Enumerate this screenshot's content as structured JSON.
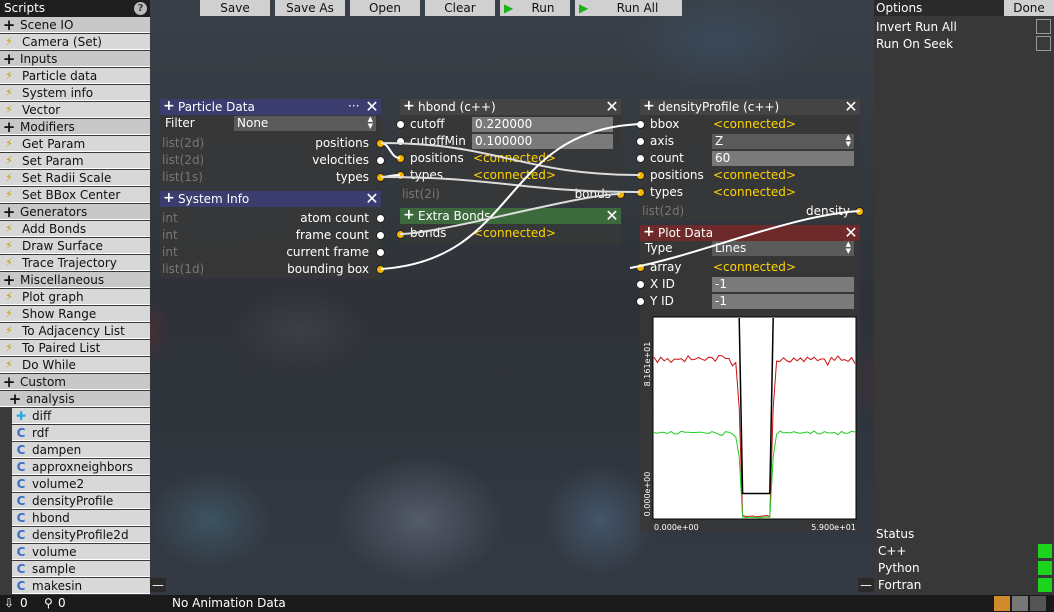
{
  "toolbar": {
    "save": "Save",
    "save_as": "Save As",
    "open": "Open",
    "clear": "Clear",
    "run": "Run",
    "run_all": "Run All"
  },
  "left_panel": {
    "title": "Scripts",
    "help": "?",
    "collapse": "—",
    "items": [
      {
        "label": "Scene IO",
        "icon": "plus-icon",
        "kind": "category"
      },
      {
        "label": "Camera (Set)",
        "icon": "bolt-icon",
        "kind": "item"
      },
      {
        "label": "Inputs",
        "icon": "plus-icon",
        "kind": "category"
      },
      {
        "label": "Particle data",
        "icon": "bolt-icon",
        "kind": "item"
      },
      {
        "label": "System info",
        "icon": "bolt-icon",
        "kind": "item"
      },
      {
        "label": "Vector",
        "icon": "bolt-icon",
        "kind": "item"
      },
      {
        "label": "Modifiers",
        "icon": "plus-icon",
        "kind": "category"
      },
      {
        "label": "Get Param",
        "icon": "bolt-icon",
        "kind": "item"
      },
      {
        "label": "Set Param",
        "icon": "bolt-icon",
        "kind": "item"
      },
      {
        "label": "Set Radii Scale",
        "icon": "bolt-icon",
        "kind": "item"
      },
      {
        "label": "Set BBox Center",
        "icon": "bolt-icon",
        "kind": "item"
      },
      {
        "label": "Generators",
        "icon": "plus-icon",
        "kind": "category"
      },
      {
        "label": "Add Bonds",
        "icon": "bolt-icon",
        "kind": "item"
      },
      {
        "label": "Draw Surface",
        "icon": "bolt-icon",
        "kind": "item"
      },
      {
        "label": "Trace Trajectory",
        "icon": "bolt-icon",
        "kind": "item"
      },
      {
        "label": "Miscellaneous",
        "icon": "plus-icon",
        "kind": "category"
      },
      {
        "label": "Plot graph",
        "icon": "bolt-icon",
        "kind": "item"
      },
      {
        "label": "Show Range",
        "icon": "bolt-icon",
        "kind": "item"
      },
      {
        "label": "To Adjacency List",
        "icon": "bolt-icon",
        "kind": "item"
      },
      {
        "label": "To Paired List",
        "icon": "bolt-icon",
        "kind": "item"
      },
      {
        "label": "Do While",
        "icon": "bolt-icon",
        "kind": "item"
      },
      {
        "label": "Custom",
        "icon": "plus-icon",
        "kind": "category"
      },
      {
        "label": "analysis",
        "icon": "plus-icon",
        "kind": "subcategory"
      },
      {
        "label": "diff",
        "icon": "cross-icon",
        "kind": "script"
      },
      {
        "label": "rdf",
        "icon": "c-icon",
        "kind": "script"
      },
      {
        "label": "dampen",
        "icon": "c-icon",
        "kind": "script"
      },
      {
        "label": "approxneighbors",
        "icon": "c-icon",
        "kind": "script"
      },
      {
        "label": "volume2",
        "icon": "c-icon",
        "kind": "script"
      },
      {
        "label": "densityProfile",
        "icon": "c-icon",
        "kind": "script"
      },
      {
        "label": "hbond",
        "icon": "c-icon",
        "kind": "script"
      },
      {
        "label": "densityProfile2d",
        "icon": "c-icon",
        "kind": "script"
      },
      {
        "label": "volume",
        "icon": "c-icon",
        "kind": "script"
      },
      {
        "label": "sample",
        "icon": "c-icon",
        "kind": "script"
      },
      {
        "label": "makesin",
        "icon": "c-icon",
        "kind": "script"
      }
    ]
  },
  "right_panel": {
    "title": "Options",
    "done": "Done",
    "invert_run_all": "Invert Run All",
    "run_on_seek": "Run On Seek",
    "status_title": "Status",
    "status": [
      {
        "label": "C++",
        "color": "#1cd41c"
      },
      {
        "label": "Python",
        "color": "#1cd41c"
      },
      {
        "label": "Fortran",
        "color": "#1cd41c"
      }
    ],
    "collapse": "—"
  },
  "status_bar": {
    "count1": "0",
    "count2": "0",
    "message": "No Animation Data"
  },
  "nodes": {
    "particle_data": {
      "title": "Particle Data",
      "menu": "···",
      "filter_label": "Filter",
      "filter_value": "None",
      "outputs": [
        {
          "type": "list(2d)",
          "label": "positions"
        },
        {
          "type": "list(2d)",
          "label": "velocities"
        },
        {
          "type": "list(1s)",
          "label": "types"
        }
      ]
    },
    "system_info": {
      "title": "System Info",
      "outputs": [
        {
          "type": "int",
          "label": "atom count"
        },
        {
          "type": "int",
          "label": "frame count"
        },
        {
          "type": "int",
          "label": "current frame"
        },
        {
          "type": "list(1d)",
          "label": "bounding box"
        }
      ]
    },
    "hbond": {
      "title": "hbond (c++)",
      "inputs": [
        {
          "label": "cutoff",
          "value": "0.220000"
        },
        {
          "label": "cutoffMin",
          "value": "0.100000"
        },
        {
          "label": "positions",
          "value": "<connected>"
        },
        {
          "label": "types",
          "value": "<connected>"
        }
      ],
      "output": {
        "type": "list(2i)",
        "label": "bonds"
      }
    },
    "extra_bonds": {
      "title": "Extra Bonds",
      "input": {
        "label": "bonds",
        "value": "<connected>"
      }
    },
    "density_profile": {
      "title": "densityProfile (c++)",
      "inputs": [
        {
          "label": "bbox",
          "value": "<connected>"
        },
        {
          "label": "axis",
          "value": "Z"
        },
        {
          "label": "count",
          "value": "60"
        },
        {
          "label": "positions",
          "value": "<connected>"
        },
        {
          "label": "types",
          "value": "<connected>"
        }
      ],
      "output": {
        "type": "list(2d)",
        "label": "density"
      }
    },
    "plot_data": {
      "title": "Plot Data",
      "type_label": "Type",
      "type_value": "Lines",
      "inputs": [
        {
          "label": "array",
          "value": "<connected>"
        },
        {
          "label": "X ID",
          "value": "-1"
        },
        {
          "label": "Y ID",
          "value": "-1"
        }
      ]
    }
  },
  "chart_data": {
    "type": "line",
    "ylabels": [
      "8.161e+01",
      "0.000e+00"
    ],
    "xlabels": [
      "0.000e+00",
      "5.900e+01"
    ],
    "ylim": [
      0,
      81.61
    ],
    "xlim": [
      0,
      59
    ],
    "grid": false,
    "x": [
      0,
      1,
      2,
      3,
      4,
      5,
      6,
      7,
      8,
      9,
      10,
      11,
      12,
      13,
      14,
      15,
      16,
      17,
      18,
      19,
      20,
      21,
      22,
      23,
      24,
      25,
      26,
      27,
      28,
      29,
      30,
      31,
      32,
      33,
      34,
      35,
      36,
      37,
      38,
      39,
      40,
      41,
      42,
      43,
      44,
      45,
      46,
      47,
      48,
      49,
      50,
      51,
      52,
      53,
      54,
      55,
      56,
      57,
      58,
      59
    ],
    "series": [
      {
        "color": "#cc1111",
        "values": [
          65.6,
          63.5,
          65.6,
          64.1,
          65.1,
          63.5,
          64.9,
          64.7,
          65.0,
          63.8,
          66.2,
          64.6,
          64.7,
          65.5,
          64.8,
          64.3,
          65.6,
          65.5,
          64.0,
          66.3,
          66.2,
          65.1,
          65.1,
          62.1,
          63.4,
          45.0,
          1.0,
          0.6,
          0.7,
          0.8,
          0.5,
          0.6,
          0.8,
          1.0,
          0.7,
          45.0,
          64.0,
          63.9,
          65.4,
          64.1,
          63.6,
          65.3,
          64.1,
          65.3,
          63.8,
          65.6,
          64.6,
          65.6,
          64.2,
          64.9,
          64.9,
          62.4,
          65.5,
          64.3,
          66.1,
          64.4,
          64.6,
          63.9,
          65.5,
          63.0
        ]
      },
      {
        "color": "#22cc22",
        "values": [
          34.9,
          34.6,
          35.0,
          34.9,
          34.5,
          35.3,
          34.3,
          34.4,
          35.4,
          35.0,
          35.0,
          34.9,
          34.9,
          35.0,
          35.0,
          34.7,
          34.5,
          35.2,
          34.8,
          34.1,
          33.7,
          35.2,
          35.0,
          34.3,
          33.0,
          25.0,
          0.4,
          0.2,
          0.3,
          0.3,
          0.2,
          0.1,
          0.3,
          0.4,
          0.3,
          25.0,
          34.1,
          35.5,
          34.7,
          34.9,
          34.7,
          35.2,
          34.8,
          34.6,
          34.9,
          35.1,
          34.5,
          35.5,
          34.4,
          34.3,
          35.2,
          34.8,
          34.7,
          34.9,
          34.0,
          35.3,
          34.6,
          34.6,
          35.4,
          35.1
        ]
      },
      {
        "color": "#000000",
        "values": [
          null,
          null,
          null,
          null,
          null,
          null,
          null,
          null,
          null,
          null,
          null,
          null,
          null,
          null,
          null,
          null,
          null,
          null,
          null,
          null,
          null,
          null,
          null,
          null,
          null,
          81.61,
          10.0,
          10.0,
          10.0,
          10.0,
          10.0,
          10.0,
          10.0,
          10.0,
          10.0,
          81.61,
          null,
          null,
          null,
          null,
          null,
          null,
          null,
          null,
          null,
          null,
          null,
          null,
          null,
          null,
          null,
          null,
          null,
          null,
          null,
          null,
          null,
          null,
          null,
          null
        ]
      }
    ]
  }
}
